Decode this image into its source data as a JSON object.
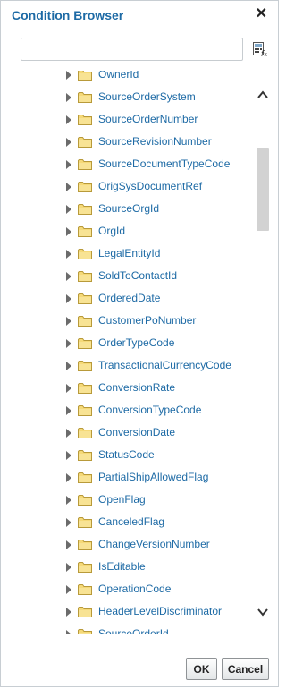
{
  "dialog": {
    "title": "Condition Browser",
    "close_glyph": "✕"
  },
  "search": {
    "value": "",
    "placeholder": ""
  },
  "toolbar": {
    "calculator_icon": "calculator-fx-icon"
  },
  "tree": {
    "items": [
      {
        "label": "OwnerId"
      },
      {
        "label": "SourceOrderSystem"
      },
      {
        "label": "SourceOrderNumber"
      },
      {
        "label": "SourceRevisionNumber"
      },
      {
        "label": "SourceDocumentTypeCode"
      },
      {
        "label": "OrigSysDocumentRef"
      },
      {
        "label": "SourceOrgId"
      },
      {
        "label": "OrgId"
      },
      {
        "label": "LegalEntityId"
      },
      {
        "label": "SoldToContactId"
      },
      {
        "label": "OrderedDate"
      },
      {
        "label": "CustomerPoNumber"
      },
      {
        "label": "OrderTypeCode"
      },
      {
        "label": "TransactionalCurrencyCode"
      },
      {
        "label": "ConversionRate"
      },
      {
        "label": "ConversionTypeCode"
      },
      {
        "label": "ConversionDate"
      },
      {
        "label": "StatusCode"
      },
      {
        "label": "PartialShipAllowedFlag"
      },
      {
        "label": "OpenFlag"
      },
      {
        "label": "CanceledFlag"
      },
      {
        "label": "ChangeVersionNumber"
      },
      {
        "label": "IsEditable"
      },
      {
        "label": "OperationCode"
      },
      {
        "label": "HeaderLevelDiscriminator"
      },
      {
        "label": "SourceOrderId"
      }
    ],
    "scroll_position": 0.18
  },
  "buttons": {
    "ok_label": "OK",
    "cancel_label": "Cancel"
  },
  "colors": {
    "accent": "#1d6aa5",
    "folder": "#f5d978"
  }
}
